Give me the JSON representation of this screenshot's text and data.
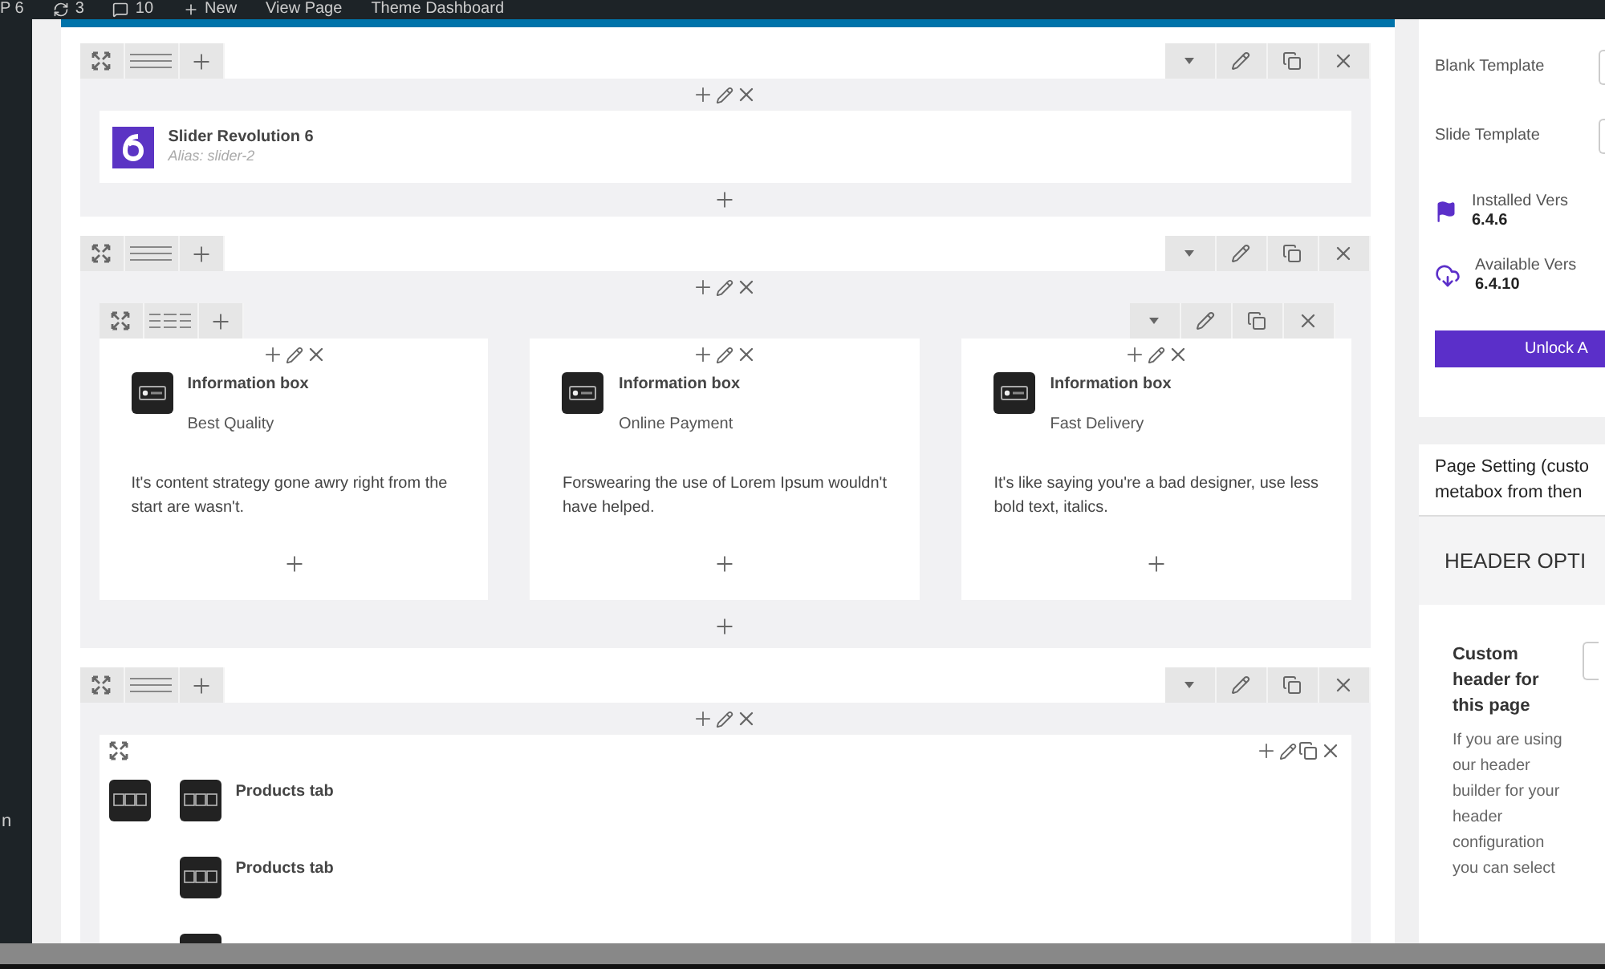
{
  "admin_bar": [
    {
      "kind": "text",
      "label": "P 6"
    },
    {
      "kind": "updates",
      "label": "3"
    },
    {
      "kind": "comments",
      "label": "10"
    },
    {
      "kind": "new",
      "label": "New"
    },
    {
      "kind": "text",
      "label": "View Page"
    },
    {
      "kind": "text",
      "label": "Theme Dashboard"
    }
  ],
  "sidebar": {
    "label": "n"
  },
  "rows": [
    {
      "kind": "slider",
      "title": "Slider Revolution 6",
      "subtitle": "Alias: slider-2"
    },
    {
      "kind": "info_boxes",
      "boxes": [
        {
          "title": "Information box",
          "subtitle": "Best Quality",
          "text": "It's content strategy gone awry right from the start are wasn't."
        },
        {
          "title": "Information box",
          "subtitle": "Online Payment",
          "text": "Forswearing the use of Lorem Ipsum wouldn't have helped."
        },
        {
          "title": "Information box",
          "subtitle": "Fast Delivery",
          "text": "It's like saying you're a bad designer, use less bold text, italics."
        }
      ]
    },
    {
      "kind": "tabs",
      "items": [
        {
          "kind": "tab",
          "title": "Products tab"
        },
        {
          "kind": "tab",
          "title": "Products tab"
        },
        {
          "kind": "icon"
        }
      ]
    }
  ],
  "panel": {
    "templates": [
      "Blank Template",
      "Slide Template"
    ],
    "versions": [
      {
        "kind": "installed",
        "label": "Installed Vers",
        "value": "6.4.6"
      },
      {
        "kind": "available",
        "label": "Available Vers",
        "value": "6.4.10"
      }
    ],
    "button": "Unlock A",
    "page_setting": [
      "Page Setting (custo",
      "metabox from then"
    ],
    "section": "HEADER OPTI",
    "option_label": "Custom header for this page",
    "option_help": "If you are using our header builder for your header configuration you can select"
  }
}
